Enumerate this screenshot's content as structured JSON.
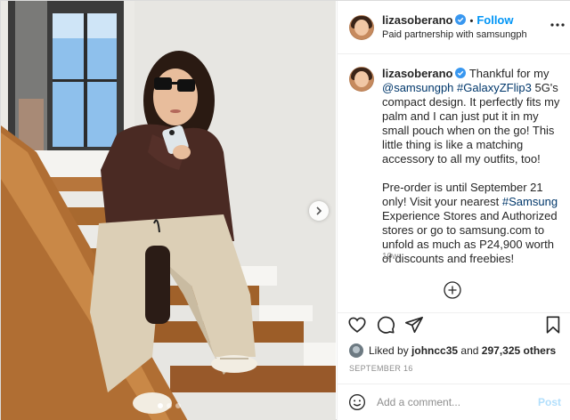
{
  "post": {
    "username": "lizasoberano",
    "follow_label": "Follow",
    "separator": "•",
    "partnership_text": "Paid partnership with samsungph",
    "more_icon": "more-horizontal-icon"
  },
  "caption": {
    "username": "lizasoberano",
    "line_intro": "Thankful for my",
    "mention": "@samsungph",
    "hashtag": "#GalaxyZFlip3",
    "text_after_hashtag": "5G's compact design. It perfectly fits my palm and I can just put it in my small pouch when on the go! This little thing is like a matching accessory to all my outfits, too!",
    "para2_before": "Pre-order is until September 21 only! Visit your nearest",
    "para2_hashtag": "#Samsung",
    "para2_after": "Experience Stores and Authorized stores or go to samsung.com to unfold as much as P24,900 worth of discounts and freebies!",
    "time_ago": "10w"
  },
  "engagement": {
    "liked_prefix": "Liked by",
    "liked_user": "johncc35",
    "liked_and": "and",
    "liked_count": "297,325 others",
    "date": "SEPTEMBER 16"
  },
  "comment": {
    "placeholder": "Add a comment...",
    "post_label": "Post"
  },
  "carousel": {
    "dot_count": 3,
    "active_index": 0
  },
  "colors": {
    "accent": "#0095f6",
    "verified": "#3897f0",
    "link": "#00376b",
    "muted": "#8e8e8e",
    "post_disabled": "#b2dffc"
  }
}
